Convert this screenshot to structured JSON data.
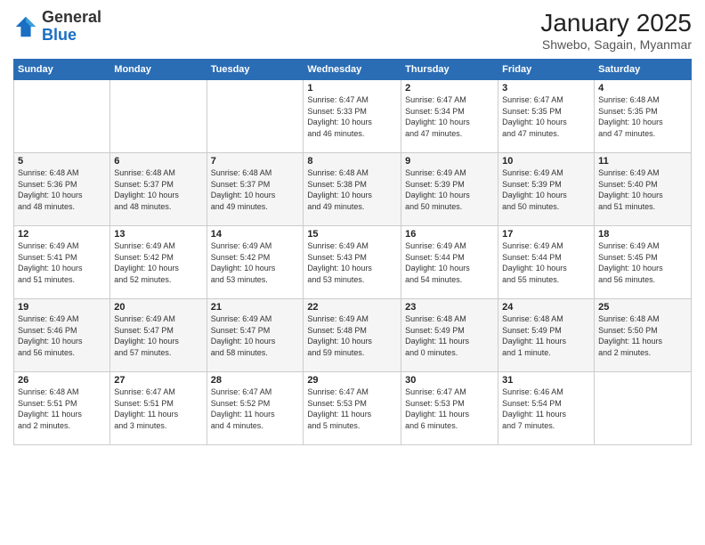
{
  "logo": {
    "general": "General",
    "blue": "Blue"
  },
  "title": "January 2025",
  "subtitle": "Shwebo, Sagain, Myanmar",
  "days": [
    "Sunday",
    "Monday",
    "Tuesday",
    "Wednesday",
    "Thursday",
    "Friday",
    "Saturday"
  ],
  "weeks": [
    [
      {
        "day": "",
        "info": ""
      },
      {
        "day": "",
        "info": ""
      },
      {
        "day": "",
        "info": ""
      },
      {
        "day": "1",
        "info": "Sunrise: 6:47 AM\nSunset: 5:33 PM\nDaylight: 10 hours\nand 46 minutes."
      },
      {
        "day": "2",
        "info": "Sunrise: 6:47 AM\nSunset: 5:34 PM\nDaylight: 10 hours\nand 47 minutes."
      },
      {
        "day": "3",
        "info": "Sunrise: 6:47 AM\nSunset: 5:35 PM\nDaylight: 10 hours\nand 47 minutes."
      },
      {
        "day": "4",
        "info": "Sunrise: 6:48 AM\nSunset: 5:35 PM\nDaylight: 10 hours\nand 47 minutes."
      }
    ],
    [
      {
        "day": "5",
        "info": "Sunrise: 6:48 AM\nSunset: 5:36 PM\nDaylight: 10 hours\nand 48 minutes."
      },
      {
        "day": "6",
        "info": "Sunrise: 6:48 AM\nSunset: 5:37 PM\nDaylight: 10 hours\nand 48 minutes."
      },
      {
        "day": "7",
        "info": "Sunrise: 6:48 AM\nSunset: 5:37 PM\nDaylight: 10 hours\nand 49 minutes."
      },
      {
        "day": "8",
        "info": "Sunrise: 6:48 AM\nSunset: 5:38 PM\nDaylight: 10 hours\nand 49 minutes."
      },
      {
        "day": "9",
        "info": "Sunrise: 6:49 AM\nSunset: 5:39 PM\nDaylight: 10 hours\nand 50 minutes."
      },
      {
        "day": "10",
        "info": "Sunrise: 6:49 AM\nSunset: 5:39 PM\nDaylight: 10 hours\nand 50 minutes."
      },
      {
        "day": "11",
        "info": "Sunrise: 6:49 AM\nSunset: 5:40 PM\nDaylight: 10 hours\nand 51 minutes."
      }
    ],
    [
      {
        "day": "12",
        "info": "Sunrise: 6:49 AM\nSunset: 5:41 PM\nDaylight: 10 hours\nand 51 minutes."
      },
      {
        "day": "13",
        "info": "Sunrise: 6:49 AM\nSunset: 5:42 PM\nDaylight: 10 hours\nand 52 minutes."
      },
      {
        "day": "14",
        "info": "Sunrise: 6:49 AM\nSunset: 5:42 PM\nDaylight: 10 hours\nand 53 minutes."
      },
      {
        "day": "15",
        "info": "Sunrise: 6:49 AM\nSunset: 5:43 PM\nDaylight: 10 hours\nand 53 minutes."
      },
      {
        "day": "16",
        "info": "Sunrise: 6:49 AM\nSunset: 5:44 PM\nDaylight: 10 hours\nand 54 minutes."
      },
      {
        "day": "17",
        "info": "Sunrise: 6:49 AM\nSunset: 5:44 PM\nDaylight: 10 hours\nand 55 minutes."
      },
      {
        "day": "18",
        "info": "Sunrise: 6:49 AM\nSunset: 5:45 PM\nDaylight: 10 hours\nand 56 minutes."
      }
    ],
    [
      {
        "day": "19",
        "info": "Sunrise: 6:49 AM\nSunset: 5:46 PM\nDaylight: 10 hours\nand 56 minutes."
      },
      {
        "day": "20",
        "info": "Sunrise: 6:49 AM\nSunset: 5:47 PM\nDaylight: 10 hours\nand 57 minutes."
      },
      {
        "day": "21",
        "info": "Sunrise: 6:49 AM\nSunset: 5:47 PM\nDaylight: 10 hours\nand 58 minutes."
      },
      {
        "day": "22",
        "info": "Sunrise: 6:49 AM\nSunset: 5:48 PM\nDaylight: 10 hours\nand 59 minutes."
      },
      {
        "day": "23",
        "info": "Sunrise: 6:48 AM\nSunset: 5:49 PM\nDaylight: 11 hours\nand 0 minutes."
      },
      {
        "day": "24",
        "info": "Sunrise: 6:48 AM\nSunset: 5:49 PM\nDaylight: 11 hours\nand 1 minute."
      },
      {
        "day": "25",
        "info": "Sunrise: 6:48 AM\nSunset: 5:50 PM\nDaylight: 11 hours\nand 2 minutes."
      }
    ],
    [
      {
        "day": "26",
        "info": "Sunrise: 6:48 AM\nSunset: 5:51 PM\nDaylight: 11 hours\nand 2 minutes."
      },
      {
        "day": "27",
        "info": "Sunrise: 6:47 AM\nSunset: 5:51 PM\nDaylight: 11 hours\nand 3 minutes."
      },
      {
        "day": "28",
        "info": "Sunrise: 6:47 AM\nSunset: 5:52 PM\nDaylight: 11 hours\nand 4 minutes."
      },
      {
        "day": "29",
        "info": "Sunrise: 6:47 AM\nSunset: 5:53 PM\nDaylight: 11 hours\nand 5 minutes."
      },
      {
        "day": "30",
        "info": "Sunrise: 6:47 AM\nSunset: 5:53 PM\nDaylight: 11 hours\nand 6 minutes."
      },
      {
        "day": "31",
        "info": "Sunrise: 6:46 AM\nSunset: 5:54 PM\nDaylight: 11 hours\nand 7 minutes."
      },
      {
        "day": "",
        "info": ""
      }
    ]
  ]
}
